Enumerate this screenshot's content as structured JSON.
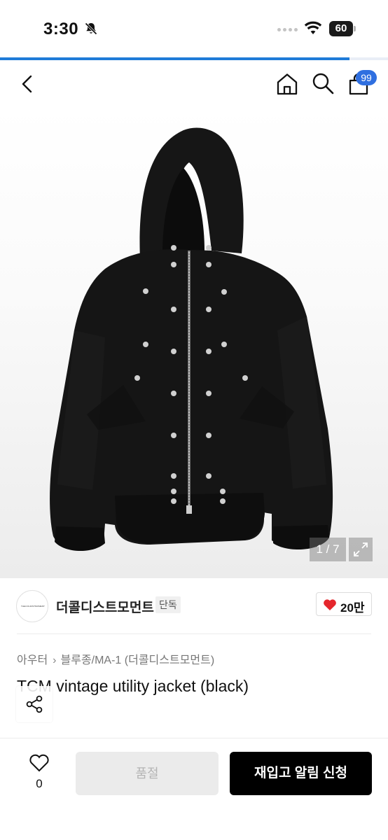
{
  "status_bar": {
    "time": "3:30",
    "battery": "60",
    "icons": [
      "bell-slash-icon",
      "wifi-icon",
      "battery-icon"
    ]
  },
  "page_load_progress": 0.9,
  "header": {
    "icons": [
      "chevron-left-icon",
      "home-icon",
      "search-icon",
      "shopping-bag-icon"
    ],
    "cart_count": "99"
  },
  "gallery": {
    "page_indicator": "1 / 7",
    "image_subject": "jacket-photo",
    "expand_icon": "expand-icon"
  },
  "brand": {
    "logo_text": "THECOLDISTMOMENT",
    "name": "더콜디스트모먼트",
    "badge": "단독",
    "like_count": "20만"
  },
  "product": {
    "breadcrumb": [
      "아우터",
      "블루종/MA-1 (더콜디스트모먼트)"
    ],
    "title": "TCM vintage utility jacket (black)"
  },
  "bottom_bar": {
    "wish_count": "0",
    "soldout_label": "품절",
    "restock_label": "재입고 알림 신청"
  },
  "colors": {
    "accent_blue": "#2f6fe0",
    "progress_blue": "#1f7bd8",
    "heart_red": "#e5262c",
    "primary_button": "#000000",
    "disabled_button": "#ebebeb"
  }
}
